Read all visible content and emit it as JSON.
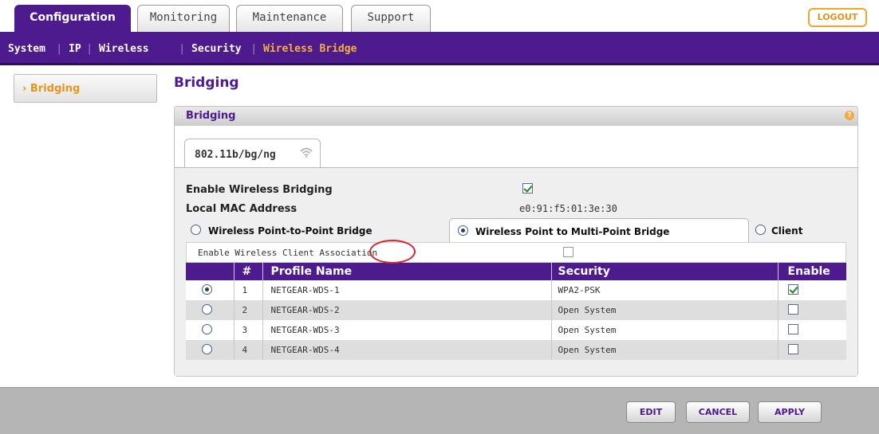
{
  "tabs": [
    {
      "label": "Configuration",
      "active": true
    },
    {
      "label": "Monitoring",
      "active": false
    },
    {
      "label": "Maintenance",
      "active": false
    },
    {
      "label": "Support",
      "active": false
    }
  ],
  "logout_label": "LOGOUT",
  "subnav": [
    {
      "label": "System",
      "active": false
    },
    {
      "label": "IP",
      "active": false
    },
    {
      "label": "Wireless",
      "active": false
    },
    {
      "label": "Security",
      "active": false
    },
    {
      "label": "Wireless Bridge",
      "active": true
    }
  ],
  "sidebar": {
    "items": [
      {
        "label": "Bridging",
        "prefix": "›",
        "active": true
      }
    ]
  },
  "page_title": "Bridging",
  "panel": {
    "title": "Bridging",
    "help_icon": "?",
    "radio_tab": "802.11b/bg/ng",
    "enable_bridging": {
      "label": "Enable Wireless Bridging",
      "checked": true
    },
    "local_mac": {
      "label": "Local MAC Address",
      "value": "e0:91:f5:01:3e:30"
    },
    "modes": [
      {
        "label": "Wireless Point-to-Point Bridge",
        "selected": false
      },
      {
        "label": "Wireless Point to Multi-Point Bridge",
        "selected": true
      },
      {
        "label": "Client",
        "selected": false
      }
    ],
    "client_association": {
      "label": "Enable Wireless Client Association",
      "checked": false
    }
  },
  "table": {
    "headers": [
      "",
      "#",
      "Profile Name",
      "Security",
      "Enable"
    ],
    "rows": [
      {
        "selected": true,
        "num": "1",
        "name": "NETGEAR-WDS-1",
        "security": "WPA2-PSK",
        "enabled": true
      },
      {
        "selected": false,
        "num": "2",
        "name": "NETGEAR-WDS-2",
        "security": "Open System",
        "enabled": false
      },
      {
        "selected": false,
        "num": "3",
        "name": "NETGEAR-WDS-3",
        "security": "Open System",
        "enabled": false
      },
      {
        "selected": false,
        "num": "4",
        "name": "NETGEAR-WDS-4",
        "security": "Open System",
        "enabled": false
      }
    ]
  },
  "footer": {
    "edit": "EDIT",
    "cancel": "CANCEL",
    "apply": "APPLY"
  },
  "colors": {
    "brand_purple": "#4d1b8d",
    "accent_orange": "#f3a72a",
    "highlight_red": "#d9252b"
  }
}
